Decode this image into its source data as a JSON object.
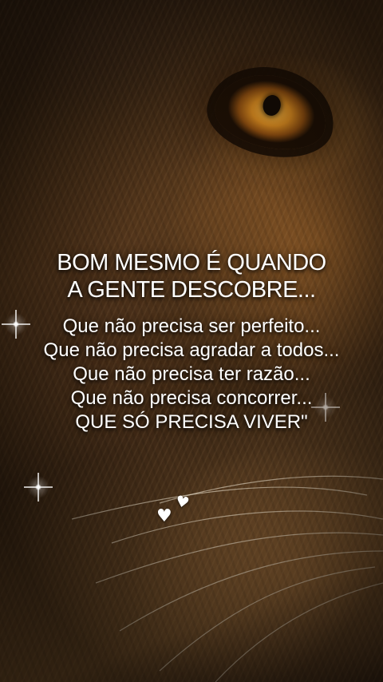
{
  "headline": {
    "line1": "BOM MESMO É QUANDO",
    "line2": "A GENTE DESCOBRE..."
  },
  "lines": [
    "Que não precisa ser perfeito...",
    "Que não precisa agradar a todos...",
    "Que não precisa ter razão...",
    "Que não precisa concorrer...",
    "QUE SÓ PRECISA VIVER\""
  ],
  "decorations": {
    "hearts": [
      "♥",
      "♥"
    ],
    "heart_color": "#ffffff",
    "eye_color": "#e0a030"
  }
}
